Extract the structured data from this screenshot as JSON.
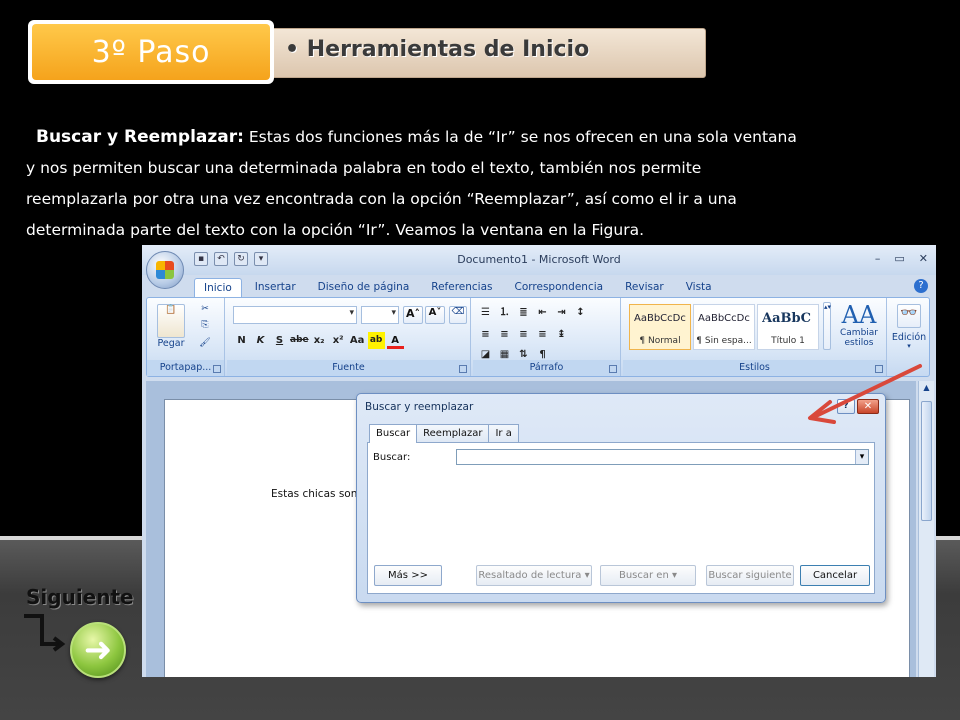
{
  "slide": {
    "step_label": "3º  Paso",
    "header_bullet": "Herramientas de Inicio",
    "paragraph": {
      "lead": "Buscar y Reemplazar:",
      "line1_rest": " Estas dos funciones más la de “Ir” se nos ofrecen en una sola ventana",
      "line2": "y nos permiten buscar una determinada palabra en todo el texto, también nos permite",
      "line3": "reemplazarla por otra una vez encontrada con la opción “Reemplazar”, así como el ir a una",
      "line4": "determinada parte del texto con la opción “Ir”. Veamos la ventana en la Figura."
    },
    "next_label": "Siguiente",
    "next_icon": "arrow-right-icon"
  },
  "word": {
    "window_title": "Documento1 - Microsoft Word",
    "window_controls": [
      "–",
      "▭",
      "✕"
    ],
    "tabs": [
      "Inicio",
      "Insertar",
      "Diseño de página",
      "Referencias",
      "Correspondencia",
      "Revisar",
      "Vista"
    ],
    "groups": {
      "clipboard": {
        "label": "Portapap...",
        "paste_label": "Pegar"
      },
      "font": {
        "label": "Fuente",
        "buttons": [
          "N",
          "K",
          "S",
          "abe",
          "x₂",
          "x²",
          "ab",
          "A"
        ]
      },
      "paragraph": {
        "label": "Párrafo"
      },
      "styles": {
        "label": "Estilos",
        "items": [
          {
            "sample": "AaBbCcDc",
            "name": "¶ Normal"
          },
          {
            "sample": "AaBbCcDc",
            "name": "¶ Sin espa..."
          },
          {
            "sample": "AaBbC",
            "name": "Título 1"
          }
        ],
        "change_label": "Cambiar estilos"
      },
      "editing": {
        "label": "Edición"
      }
    },
    "document_text": "Estas chicas son"
  },
  "dialog": {
    "title": "Buscar y reemplazar",
    "help": "?",
    "close": "✕",
    "tabs": [
      {
        "label": "Buscar"
      },
      {
        "label": "Reemplazar"
      },
      {
        "label": "Ir a"
      }
    ],
    "find_label": "Buscar:",
    "find_value": "",
    "buttons": {
      "more": "Más >>",
      "highlight": "Resaltado de lectura ▾",
      "find_in": "Buscar en ▾",
      "find_next": "Buscar siguiente",
      "cancel": "Cancelar"
    }
  },
  "colors": {
    "step_box": "#f5a31c",
    "header_bar": "#e8d5c0",
    "annotation_arrow": "#d9483b",
    "next_button": "#8dc63f"
  }
}
